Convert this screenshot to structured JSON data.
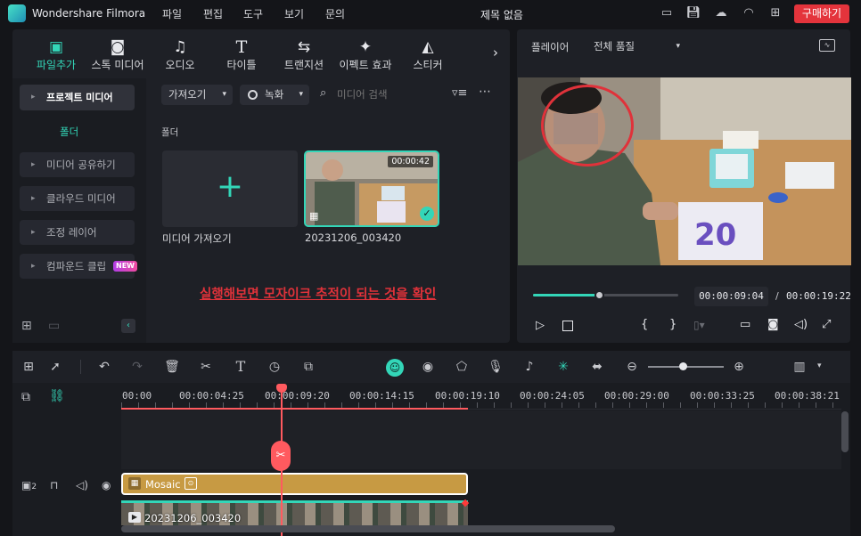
{
  "app": {
    "title": "Wondershare Filmora",
    "project_name": "제목 없음",
    "buy_label": "구매하기"
  },
  "menu": [
    "파일",
    "편집",
    "도구",
    "보기",
    "문의"
  ],
  "toolbar_tabs": [
    {
      "label": "파일추가",
      "icon": "media-icon",
      "active": true
    },
    {
      "label": "스톡 미디어",
      "icon": "stock-media-icon"
    },
    {
      "label": "오디오",
      "icon": "music-note-icon"
    },
    {
      "label": "타이틀",
      "icon": "title-t-icon"
    },
    {
      "label": "트랜지션",
      "icon": "transition-icon"
    },
    {
      "label": "이펙트 효과",
      "icon": "effects-sparkle-icon"
    },
    {
      "label": "스티커",
      "icon": "sticker-icon"
    }
  ],
  "sidebar": {
    "project_media": "프로젝트 미디어",
    "folder": "폴더",
    "items": [
      "미디어 공유하기",
      "클라우드 미디어",
      "조정 레이어",
      "컴파운드 클립"
    ],
    "new_badge": "NEW"
  },
  "media_toolbar": {
    "import_label": "가져오기",
    "record_label": "녹화",
    "search_placeholder": "미디어 검색"
  },
  "media": {
    "folder_label": "폴더",
    "import_tile_label": "미디어 가져오기",
    "clip": {
      "name": "20231206_003420",
      "duration": "00:00:42"
    },
    "annotation": "실행해보면 모자이크 추적이 되는 것을 확인"
  },
  "player": {
    "label": "플레이어",
    "quality": "전체 품질",
    "current_time": "00:00:09:04",
    "separator": "/",
    "total_time": "00:00:19:22",
    "progress": 0.46
  },
  "timeline": {
    "ruler": [
      "00:00",
      "00:00:04:25",
      "00:00:09:20",
      "00:00:14:15",
      "00:00:19:10",
      "00:00:24:05",
      "00:00:29:00",
      "00:00:33:25",
      "00:00:38:21"
    ],
    "mosaic_clip_label": "Mosaic",
    "video_clip_label": "20231206_003420",
    "track_number": "2"
  },
  "colors": {
    "accent": "#33d6b8",
    "buy": "#e4343c",
    "annotation": "#e0323a",
    "playhead": "#ff5a5f",
    "mosaic_clip": "#c79a43"
  }
}
